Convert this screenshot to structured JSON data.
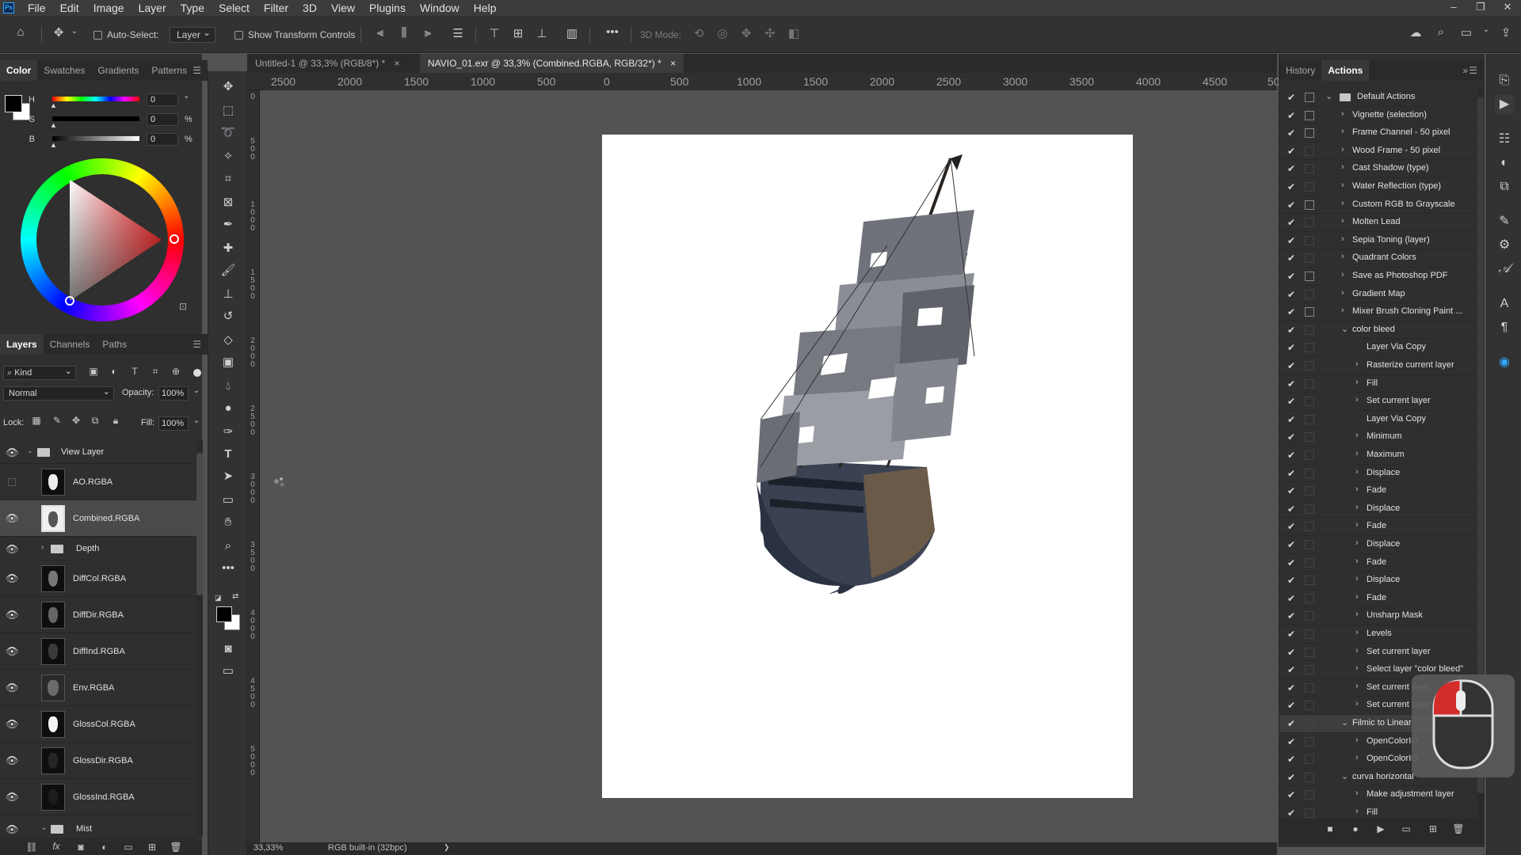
{
  "app": {
    "logo_text": "Ps"
  },
  "menu": [
    "File",
    "Edit",
    "Image",
    "Layer",
    "Type",
    "Select",
    "Filter",
    "3D",
    "View",
    "Plugins",
    "Window",
    "Help"
  ],
  "window_controls": {
    "minimize": "–",
    "restore": "❐",
    "close": "✕"
  },
  "options_bar": {
    "auto_select_label": "Auto-Select:",
    "auto_select_target": "Layer",
    "show_transform_label": "Show Transform Controls",
    "three_d_mode_label": "3D Mode:",
    "more_label": "•••"
  },
  "color_panel": {
    "tabs": [
      "Color",
      "Swatches",
      "Gradients",
      "Patterns"
    ],
    "active_tab": "Color",
    "sliders": [
      {
        "label": "H",
        "value": "0",
        "unit": "°"
      },
      {
        "label": "S",
        "value": "0",
        "unit": "%"
      },
      {
        "label": "B",
        "value": "0",
        "unit": "%"
      }
    ]
  },
  "layers_panel": {
    "tabs": [
      "Layers",
      "Channels",
      "Paths"
    ],
    "active_tab": "Layers",
    "filter_kind": "Kind",
    "blend_mode": "Normal",
    "opacity_label": "Opacity:",
    "opacity_value": "100%",
    "lock_label": "Lock:",
    "fill_label": "Fill:",
    "fill_value": "100%",
    "layers": [
      {
        "name": "View Layer",
        "type": "group",
        "visible": true
      },
      {
        "name": "AO.RGBA",
        "type": "layer",
        "visible": false
      },
      {
        "name": "Combined.RGBA",
        "type": "layer",
        "visible": true,
        "selected": true
      },
      {
        "name": "Depth",
        "type": "group",
        "visible": true
      },
      {
        "name": "DiffCol.RGBA",
        "type": "layer",
        "visible": true
      },
      {
        "name": "DiffDir.RGBA",
        "type": "layer",
        "visible": true
      },
      {
        "name": "DiffInd.RGBA",
        "type": "layer",
        "visible": true
      },
      {
        "name": "Env.RGBA",
        "type": "layer",
        "visible": true
      },
      {
        "name": "GlossCol.RGBA",
        "type": "layer",
        "visible": true
      },
      {
        "name": "GlossDir.RGBA",
        "type": "layer",
        "visible": true
      },
      {
        "name": "GlossInd.RGBA",
        "type": "layer",
        "visible": true
      },
      {
        "name": "Mist",
        "type": "group",
        "visible": true
      }
    ],
    "footer_fx": "fx"
  },
  "doc_tabs": [
    {
      "label": "Untitled-1 @ 33,3% (RGB/8*) *",
      "active": false
    },
    {
      "label": "NAVIO_01.exr @ 33,3% (Combined.RGBA, RGB/32*) *",
      "active": true
    }
  ],
  "ruler": {
    "top": [
      "2500",
      "2000",
      "1500",
      "1000",
      "500",
      "0",
      "500",
      "1000",
      "1500",
      "2000",
      "2500",
      "3000",
      "3500",
      "4000",
      "4500",
      "50"
    ],
    "left": [
      "0",
      "5 0 0",
      "1 0 0 0",
      "1 5 0 0",
      "2 0 0 0",
      "2 5 0 0",
      "3 0 0 0",
      "3 5 0 0",
      "4 0 0 0",
      "4 5 0 0",
      "5 0 0 0"
    ]
  },
  "status": {
    "zoom": "33,33%",
    "profile": "RGB built-in (32bpc)",
    "arrow": "❯"
  },
  "actions_panel": {
    "tabs": [
      "History",
      "Actions"
    ],
    "active_tab": "Actions",
    "items": [
      {
        "label": "Default Actions",
        "level": 0,
        "expanded": true,
        "is_set": true,
        "dialog": true
      },
      {
        "label": "Vignette (selection)",
        "level": 1,
        "dialog": true
      },
      {
        "label": "Frame Channel - 50 pixel",
        "level": 1,
        "dialog": true
      },
      {
        "label": "Wood Frame - 50 pixel",
        "level": 1
      },
      {
        "label": "Cast Shadow (type)",
        "level": 1
      },
      {
        "label": "Water Reflection (type)",
        "level": 1
      },
      {
        "label": "Custom RGB to Grayscale",
        "level": 1,
        "dialog": true
      },
      {
        "label": "Molten Lead",
        "level": 1
      },
      {
        "label": "Sepia Toning (layer)",
        "level": 1
      },
      {
        "label": "Quadrant Colors",
        "level": 1
      },
      {
        "label": "Save as Photoshop PDF",
        "level": 1,
        "dialog": true
      },
      {
        "label": "Gradient Map",
        "level": 1
      },
      {
        "label": "Mixer Brush Cloning Paint ...",
        "level": 1,
        "dialog": true
      },
      {
        "label": "color bleed",
        "level": 1,
        "expanded": true
      },
      {
        "label": "Layer Via Copy",
        "level": 2,
        "nochev": true
      },
      {
        "label": "Rasterize current layer",
        "level": 2
      },
      {
        "label": "Fill",
        "level": 2
      },
      {
        "label": "Set current layer",
        "level": 2
      },
      {
        "label": "Layer Via Copy",
        "level": 2,
        "nochev": true
      },
      {
        "label": "Minimum",
        "level": 2
      },
      {
        "label": "Maximum",
        "level": 2
      },
      {
        "label": "Displace",
        "level": 2
      },
      {
        "label": "Fade",
        "level": 2
      },
      {
        "label": "Displace",
        "level": 2
      },
      {
        "label": "Fade",
        "level": 2
      },
      {
        "label": "Displace",
        "level": 2
      },
      {
        "label": "Fade",
        "level": 2
      },
      {
        "label": "Displace",
        "level": 2
      },
      {
        "label": "Fade",
        "level": 2
      },
      {
        "label": "Unsharp Mask",
        "level": 2
      },
      {
        "label": "Levels",
        "level": 2
      },
      {
        "label": "Set current layer",
        "level": 2
      },
      {
        "label": "Select layer \"color bleed\"",
        "level": 2
      },
      {
        "label": "Set current layer",
        "level": 2
      },
      {
        "label": "Set current layer",
        "level": 2
      },
      {
        "label": "Filmic to Linear",
        "level": 1,
        "expanded": true,
        "highlight": true
      },
      {
        "label": "OpenColorIO",
        "level": 2
      },
      {
        "label": "OpenColorIO",
        "level": 2
      },
      {
        "label": "curva horizontal",
        "level": 1,
        "expanded": true
      },
      {
        "label": "Make adjustment layer",
        "level": 2
      },
      {
        "label": "Fill",
        "level": 2
      }
    ]
  },
  "colors": {
    "accent": "#31a8ff",
    "panel": "#2f2f2f",
    "canvas": "#535353"
  }
}
